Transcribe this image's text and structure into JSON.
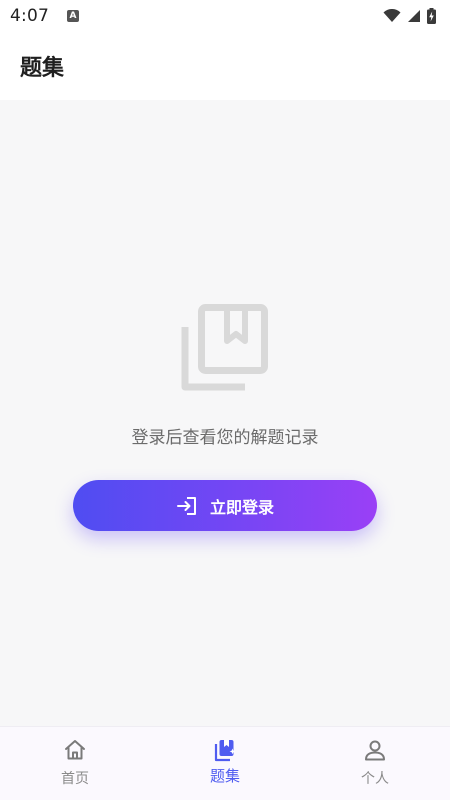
{
  "status_bar": {
    "time": "4:07",
    "app_icon_letter": "A",
    "icons": [
      "wifi-icon",
      "signal-icon",
      "battery-charging-icon"
    ]
  },
  "header": {
    "title": "题集"
  },
  "empty_state": {
    "icon": "book-icon",
    "message": "登录后查看您的解题记录",
    "login_button": {
      "icon": "login-icon",
      "label": "立即登录"
    }
  },
  "bottom_nav": {
    "items": [
      {
        "label": "首页",
        "icon": "home-icon",
        "active": false
      },
      {
        "label": "题集",
        "icon": "question-set-icon",
        "active": true
      },
      {
        "label": "个人",
        "icon": "person-icon",
        "active": false
      }
    ]
  },
  "colors": {
    "accent": "#4f5cf0",
    "button_gradient_start": "#4f4df2",
    "button_gradient_end": "#9a40f6",
    "background": "#f7f7f8"
  }
}
